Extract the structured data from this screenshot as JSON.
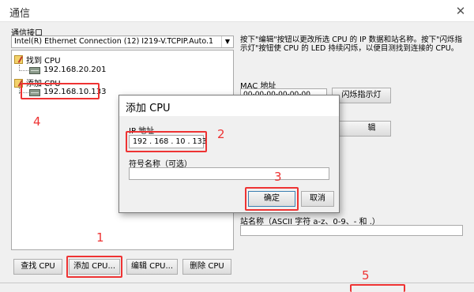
{
  "window": {
    "title": "通信",
    "close_glyph": "✕"
  },
  "interface": {
    "label": "通信接口",
    "selected": "Intel(R) Ethernet Connection (12) I219-V.TCPIP.Auto.1"
  },
  "tree": {
    "found_label": "找到 CPU",
    "found_ip": "192.168.20.201",
    "added_label": "添加 CPU",
    "added_ip": "192.168.10.133"
  },
  "right_panel": {
    "description": "按下\"编辑\"按钮以更改所选 CPU 的 IP 数据和站名称。按下\"闪烁指示灯\"按钮使 CPU 的 LED 持续闪烁，以便目测找到连接的 CPU。",
    "mac_label": "MAC 地址",
    "mac_value": "00-00-00-00-00-00",
    "blink_button": "闪烁指示灯",
    "edit_button_partial": "辑",
    "station_label": "站名称（ASCII 字符 a-z、0-9、- 和 .）",
    "station_value": ""
  },
  "bottom_buttons": {
    "find_cpu": "查找 CPU",
    "add_cpu": "添加 CPU...",
    "edit_cpu": "编辑 CPU...",
    "delete_cpu": "删除 CPU"
  },
  "dialog": {
    "title": "添加 CPU",
    "ip_label": "IP 地址",
    "ip_value": "192 . 168 . 10 . 133",
    "symbol_label": "符号名称（可选）",
    "symbol_value": "",
    "ok_button": "确定",
    "cancel_button": "取消"
  },
  "annotations": {
    "n1": "1",
    "n2": "2",
    "n3": "3",
    "n4": "4",
    "n5": "5",
    "color": "#e33333"
  }
}
